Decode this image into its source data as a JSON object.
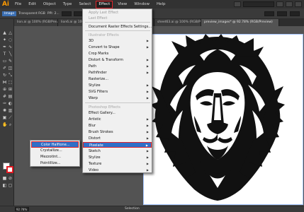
{
  "app": {
    "logo": "Ai"
  },
  "menubar": {
    "items": [
      "File",
      "Edit",
      "Object",
      "Type",
      "Select",
      "Effect",
      "View",
      "Window",
      "Help"
    ]
  },
  "control_bar": {
    "tag": "Image",
    "mode": "Transparent RGB",
    "ppi": "PPI: 2..."
  },
  "doc_tabs": [
    "lion.ai @ 100% (RGB/Preview)",
    "lion6.ai @ 100% (RGB/Preview)",
    "...",
    "...",
    "sheet63.ai @ 100% (RGB/Preview)",
    "preview_images* @ 92.78% (RGB/Preview)"
  ],
  "effect_menu": {
    "items": [
      {
        "label": "Apply Last Effect",
        "state": "disabled"
      },
      {
        "label": "Last Effect",
        "state": "disabled"
      },
      {
        "label": "Document Raster Effects Settings...",
        "state": "normal"
      },
      {
        "label": "Illustrator Effects",
        "state": "header"
      },
      {
        "label": "3D",
        "state": "normal",
        "arrow": true
      },
      {
        "label": "Convert to Shape",
        "state": "normal",
        "arrow": true
      },
      {
        "label": "Crop Marks",
        "state": "normal"
      },
      {
        "label": "Distort & Transform",
        "state": "normal",
        "arrow": true
      },
      {
        "label": "Path",
        "state": "normal",
        "arrow": true
      },
      {
        "label": "Pathfinder",
        "state": "normal",
        "arrow": true
      },
      {
        "label": "Rasterize...",
        "state": "normal"
      },
      {
        "label": "Stylize",
        "state": "normal",
        "arrow": true
      },
      {
        "label": "SVG Filters",
        "state": "normal",
        "arrow": true
      },
      {
        "label": "Warp",
        "state": "normal",
        "arrow": true
      },
      {
        "label": "Photoshop Effects",
        "state": "header"
      },
      {
        "label": "Effect Gallery...",
        "state": "normal"
      },
      {
        "label": "Artistic",
        "state": "normal",
        "arrow": true
      },
      {
        "label": "Blur",
        "state": "normal",
        "arrow": true
      },
      {
        "label": "Brush Strokes",
        "state": "normal",
        "arrow": true
      },
      {
        "label": "Distort",
        "state": "normal",
        "arrow": true
      },
      {
        "label": "Pixelate",
        "state": "highlight",
        "arrow": true
      },
      {
        "label": "Sketch",
        "state": "normal",
        "arrow": true
      },
      {
        "label": "Stylize",
        "state": "normal",
        "arrow": true
      },
      {
        "label": "Texture",
        "state": "normal",
        "arrow": true
      },
      {
        "label": "Video",
        "state": "normal",
        "arrow": true
      }
    ]
  },
  "pixelate_submenu": {
    "items": [
      {
        "label": "Color Halftone...",
        "state": "highlight"
      },
      {
        "label": "Crystallize...",
        "state": "normal"
      },
      {
        "label": "Mezzotint...",
        "state": "normal"
      },
      {
        "label": "Pointillize...",
        "state": "normal"
      }
    ]
  },
  "status": {
    "zoom": "92.78%",
    "tool": "Selection"
  },
  "colors": {
    "accent_highlight": "#2f6fc8",
    "callout_red": "#e3242b",
    "ai_orange": "#ff9a00"
  }
}
